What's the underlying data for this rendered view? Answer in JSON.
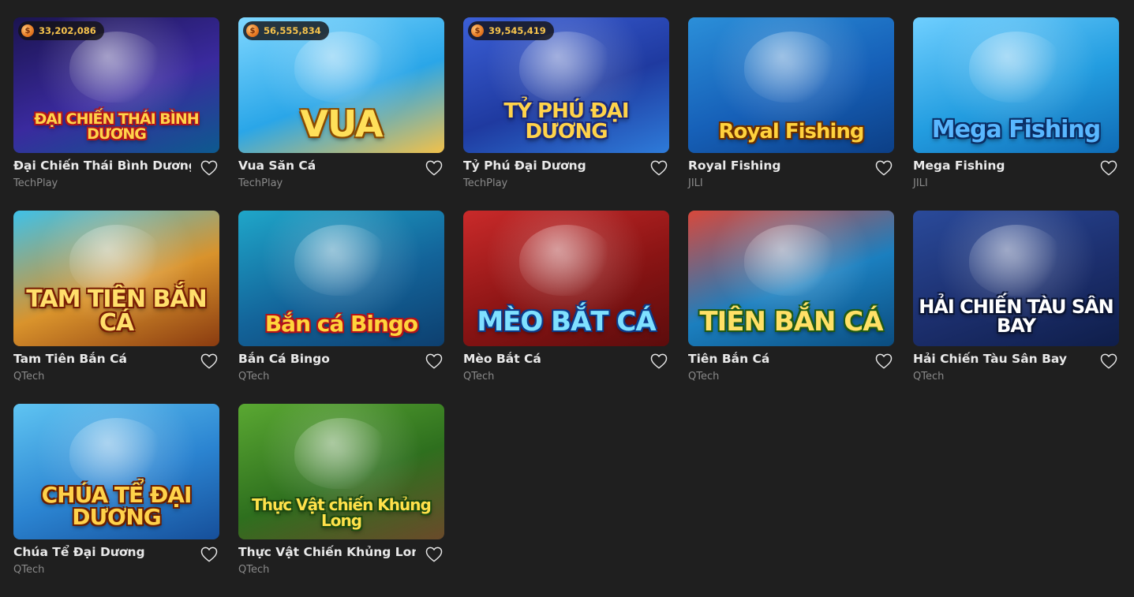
{
  "games": [
    {
      "id": "dai-chien-thai-binh-duong",
      "name": "Đại Chiến Thái Bình Dương",
      "provider": "TechPlay",
      "jackpot": "33,202,086",
      "art_text": "ĐẠI CHIẾN THÁI BÌNH DƯƠNG",
      "bg": [
        "#1b1450",
        "#3a2a9e",
        "#0d5a8f"
      ],
      "text_color": "#ffd34a",
      "stroke": "#b2151a"
    },
    {
      "id": "vua-san-ca",
      "name": "Vua Săn Cá",
      "provider": "TechPlay",
      "jackpot": "56,555,834",
      "art_text": "VUA",
      "bg": [
        "#7fd7ff",
        "#2aa6e8",
        "#f2c14a"
      ],
      "text_color": "#ffe05a",
      "stroke": "#8a4a00"
    },
    {
      "id": "ty-phu-dai-duong",
      "name": "Tỷ Phú Đại Dương",
      "provider": "TechPlay",
      "jackpot": "39,545,419",
      "art_text": "TỶ PHÚ ĐẠI DƯƠNG",
      "bg": [
        "#3b5fd6",
        "#1f3aa0",
        "#2e7bd9"
      ],
      "text_color": "#ffd34a",
      "stroke": "#1b2a7c"
    },
    {
      "id": "royal-fishing",
      "name": "Royal Fishing",
      "provider": "JILI",
      "jackpot": "",
      "art_text": "Royal Fishing",
      "bg": [
        "#2b8fd9",
        "#1660b8",
        "#0c3f86"
      ],
      "text_color": "#ffd23d",
      "stroke": "#6a2e00"
    },
    {
      "id": "mega-fishing",
      "name": "Mega Fishing",
      "provider": "JILI",
      "jackpot": "",
      "art_text": "Mega Fishing",
      "bg": [
        "#6fcfff",
        "#239de0",
        "#0f6bb5"
      ],
      "text_color": "#59b7ff",
      "stroke": "#0a2c63"
    },
    {
      "id": "tam-tien-ban-ca",
      "name": "Tam Tiên Bắn Cá",
      "provider": "QTech",
      "jackpot": "",
      "art_text": "TAM TIÊN BẮN CÁ",
      "bg": [
        "#3fc1e8",
        "#d9932c",
        "#8a3b10"
      ],
      "text_color": "#ffdf6b",
      "stroke": "#7a1f05"
    },
    {
      "id": "ban-ca-bingo",
      "name": "Bắn Cá Bingo",
      "provider": "QTech",
      "jackpot": "",
      "art_text": "Bắn cá Bingo",
      "bg": [
        "#1fa6c9",
        "#13649a",
        "#0d3f6f"
      ],
      "text_color": "#ffd43b",
      "stroke": "#b3121a"
    },
    {
      "id": "meo-bat-ca",
      "name": "Mèo Bắt Cá",
      "provider": "QTech",
      "jackpot": "",
      "art_text": "MÈO BẮT CÁ",
      "bg": [
        "#c92a2a",
        "#8a1414",
        "#5c0c0c"
      ],
      "text_color": "#7fe0ff",
      "stroke": "#0b3a8a"
    },
    {
      "id": "tien-ban-ca",
      "name": "Tiên Bắn Cá",
      "provider": "QTech",
      "jackpot": "",
      "art_text": "TIÊN BẮN CÁ",
      "bg": [
        "#d8483b",
        "#1b7fbf",
        "#0b4c7e"
      ],
      "text_color": "#ffe066",
      "stroke": "#1f5a14"
    },
    {
      "id": "hai-chien-tau-san-bay",
      "name": "Hải Chiến Tàu Sân Bay",
      "provider": "QTech",
      "jackpot": "",
      "art_text": "HẢI CHIẾN TÀU SÂN BAY",
      "bg": [
        "#2a4a9a",
        "#1c2f6e",
        "#0f1e4a"
      ],
      "text_color": "#ffffff",
      "stroke": "#0a1433"
    },
    {
      "id": "chua-te-dai-duong",
      "name": "Chúa Tể Đại Dương",
      "provider": "QTech",
      "jackpot": "",
      "art_text": "CHÚA TỂ ĐẠI DƯƠNG",
      "bg": [
        "#5fc4f2",
        "#2b84d1",
        "#164f9a"
      ],
      "text_color": "#ffd24a",
      "stroke": "#6a1e00"
    },
    {
      "id": "thuc-vat-chien-khung-long",
      "name": "Thực Vật Chiến Khủng Long",
      "provider": "QTech",
      "jackpot": "",
      "art_text": "Thực Vật chiến Khủng Long",
      "bg": [
        "#5aa832",
        "#2e6f1e",
        "#6a4a2a"
      ],
      "text_color": "#ffe14a",
      "stroke": "#1e4a10"
    }
  ],
  "coin_symbol": "$"
}
